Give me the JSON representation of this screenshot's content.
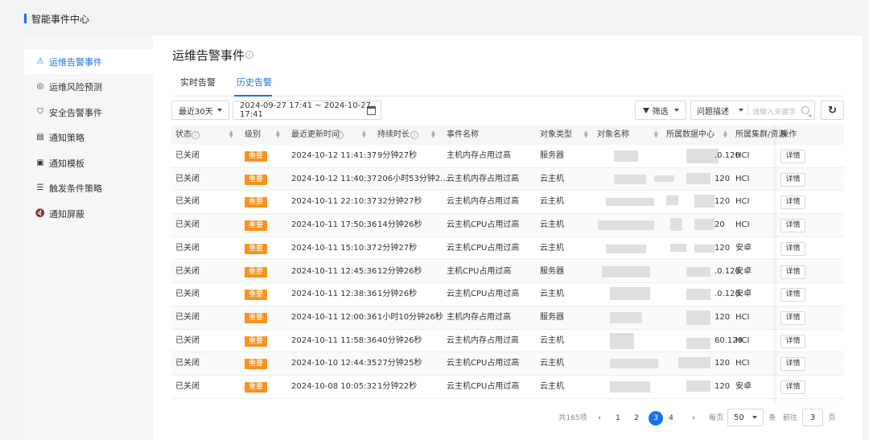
{
  "app": {
    "title": "智能事件中心"
  },
  "sidebar": {
    "items": [
      {
        "label": "运维告警事件",
        "icon": "warning-triangle-icon",
        "glyph": "⚠",
        "active": true
      },
      {
        "label": "运维风险预测",
        "icon": "risk-gauge-icon",
        "glyph": "◎",
        "active": false
      },
      {
        "label": "安全告警事件",
        "icon": "shield-icon",
        "glyph": "⛉",
        "active": false
      },
      {
        "label": "通知策略",
        "icon": "strategy-doc-icon",
        "glyph": "▤",
        "active": false
      },
      {
        "label": "通知模板",
        "icon": "template-doc-icon",
        "glyph": "▣",
        "active": false
      },
      {
        "label": "触发条件策略",
        "icon": "list-icon",
        "glyph": "☰",
        "active": false
      },
      {
        "label": "通知屏蔽",
        "icon": "mute-speaker-icon",
        "glyph": "🔇",
        "active": false
      }
    ]
  },
  "main": {
    "title": "运维告警事件",
    "tabs": [
      {
        "label": "实时告警",
        "active": false
      },
      {
        "label": "历史告警",
        "active": true
      }
    ]
  },
  "toolbar": {
    "range_select": "最近30天",
    "date_range": "2024-09-27 17:41 ~ 2024-10-27 17:41",
    "filter_label": "筛选",
    "field_select": "问题描述",
    "search_placeholder": "请输入关键字"
  },
  "table": {
    "columns": [
      "状态",
      "级别",
      "最近更新时间",
      "持续时长",
      "事件名称",
      "对象类型",
      "对象名称",
      "所属数据中心",
      "所属集群/资源",
      "操作"
    ],
    "rows": [
      {
        "status": "已关闭",
        "level": "重要",
        "time": "2024-10-12 11:41:37",
        "duration": "9分钟27秒",
        "event": "主机内存占用过高",
        "type": "服务器",
        "dc": ".0.120",
        "cluster": "HCI",
        "action": "详情"
      },
      {
        "status": "已关闭",
        "level": "重要",
        "time": "2024-10-12 11:40:37",
        "duration": "206小时53分钟2...",
        "event": "云主机内存占用过高",
        "type": "云主机",
        "dc": "120",
        "cluster": "HCI",
        "action": "详情"
      },
      {
        "status": "已关闭",
        "level": "重要",
        "time": "2024-10-11 22:10:37",
        "duration": "32分钟27秒",
        "event": "云主机内存占用过高",
        "type": "云主机",
        "dc": "120",
        "cluster": "HCI",
        "action": "详情"
      },
      {
        "status": "已关闭",
        "level": "重要",
        "time": "2024-10-11 17:50:36",
        "duration": "14分钟26秒",
        "event": "云主机CPU占用过高",
        "type": "云主机",
        "dc": "20",
        "cluster": "HCI",
        "action": "详情"
      },
      {
        "status": "已关闭",
        "level": "重要",
        "time": "2024-10-11 15:10:37",
        "duration": "2分钟27秒",
        "event": "云主机CPU占用过高",
        "type": "云主机",
        "dc": "120",
        "cluster": "安卓",
        "action": "详情"
      },
      {
        "status": "已关闭",
        "level": "重要",
        "time": "2024-10-11 12:45:36",
        "duration": "12分钟26秒",
        "event": "主机CPU占用过高",
        "type": "服务器",
        "dc": ".0.120",
        "cluster": "安卓",
        "action": "详情"
      },
      {
        "status": "已关闭",
        "level": "重要",
        "time": "2024-10-11 12:38:36",
        "duration": "1分钟26秒",
        "event": "云主机CPU占用过高",
        "type": "云主机",
        "dc": ".0.120",
        "cluster": "安卓",
        "action": "详情"
      },
      {
        "status": "已关闭",
        "level": "重要",
        "time": "2024-10-11 12:00:36",
        "duration": "1小时10分钟26秒",
        "event": "主机内存占用过高",
        "type": "服务器",
        "dc": "120",
        "cluster": "HCI",
        "action": "详情"
      },
      {
        "status": "已关闭",
        "level": "重要",
        "time": "2024-10-11 11:58:36",
        "duration": "40分钟26秒",
        "event": "云主机内存占用过高",
        "type": "云主机",
        "dc": "60.120",
        "cluster": "HCI",
        "action": "详情"
      },
      {
        "status": "已关闭",
        "level": "重要",
        "time": "2024-10-10 12:44:35",
        "duration": "27分钟25秒",
        "event": "云主机CPU占用过高",
        "type": "云主机",
        "dc": "120",
        "cluster": "HCI",
        "action": "详情"
      },
      {
        "status": "已关闭",
        "level": "重要",
        "time": "2024-10-08 10:05:32",
        "duration": "1分钟22秒",
        "event": "云主机CPU占用过高",
        "type": "云主机",
        "dc": "120",
        "cluster": "安卓",
        "action": "详情"
      }
    ]
  },
  "pagination": {
    "total_text": "共165项",
    "pages": [
      "1",
      "2",
      "3",
      "4"
    ],
    "current": "3",
    "per_page_label": "每页",
    "per_page_value": "50",
    "per_page_unit": "条",
    "goto_label": "前往",
    "goto_value": "3",
    "goto_unit": "页",
    "prev": "‹",
    "next": "›"
  },
  "colors": {
    "accent": "#1a73e8",
    "tag": "#f7931e"
  }
}
